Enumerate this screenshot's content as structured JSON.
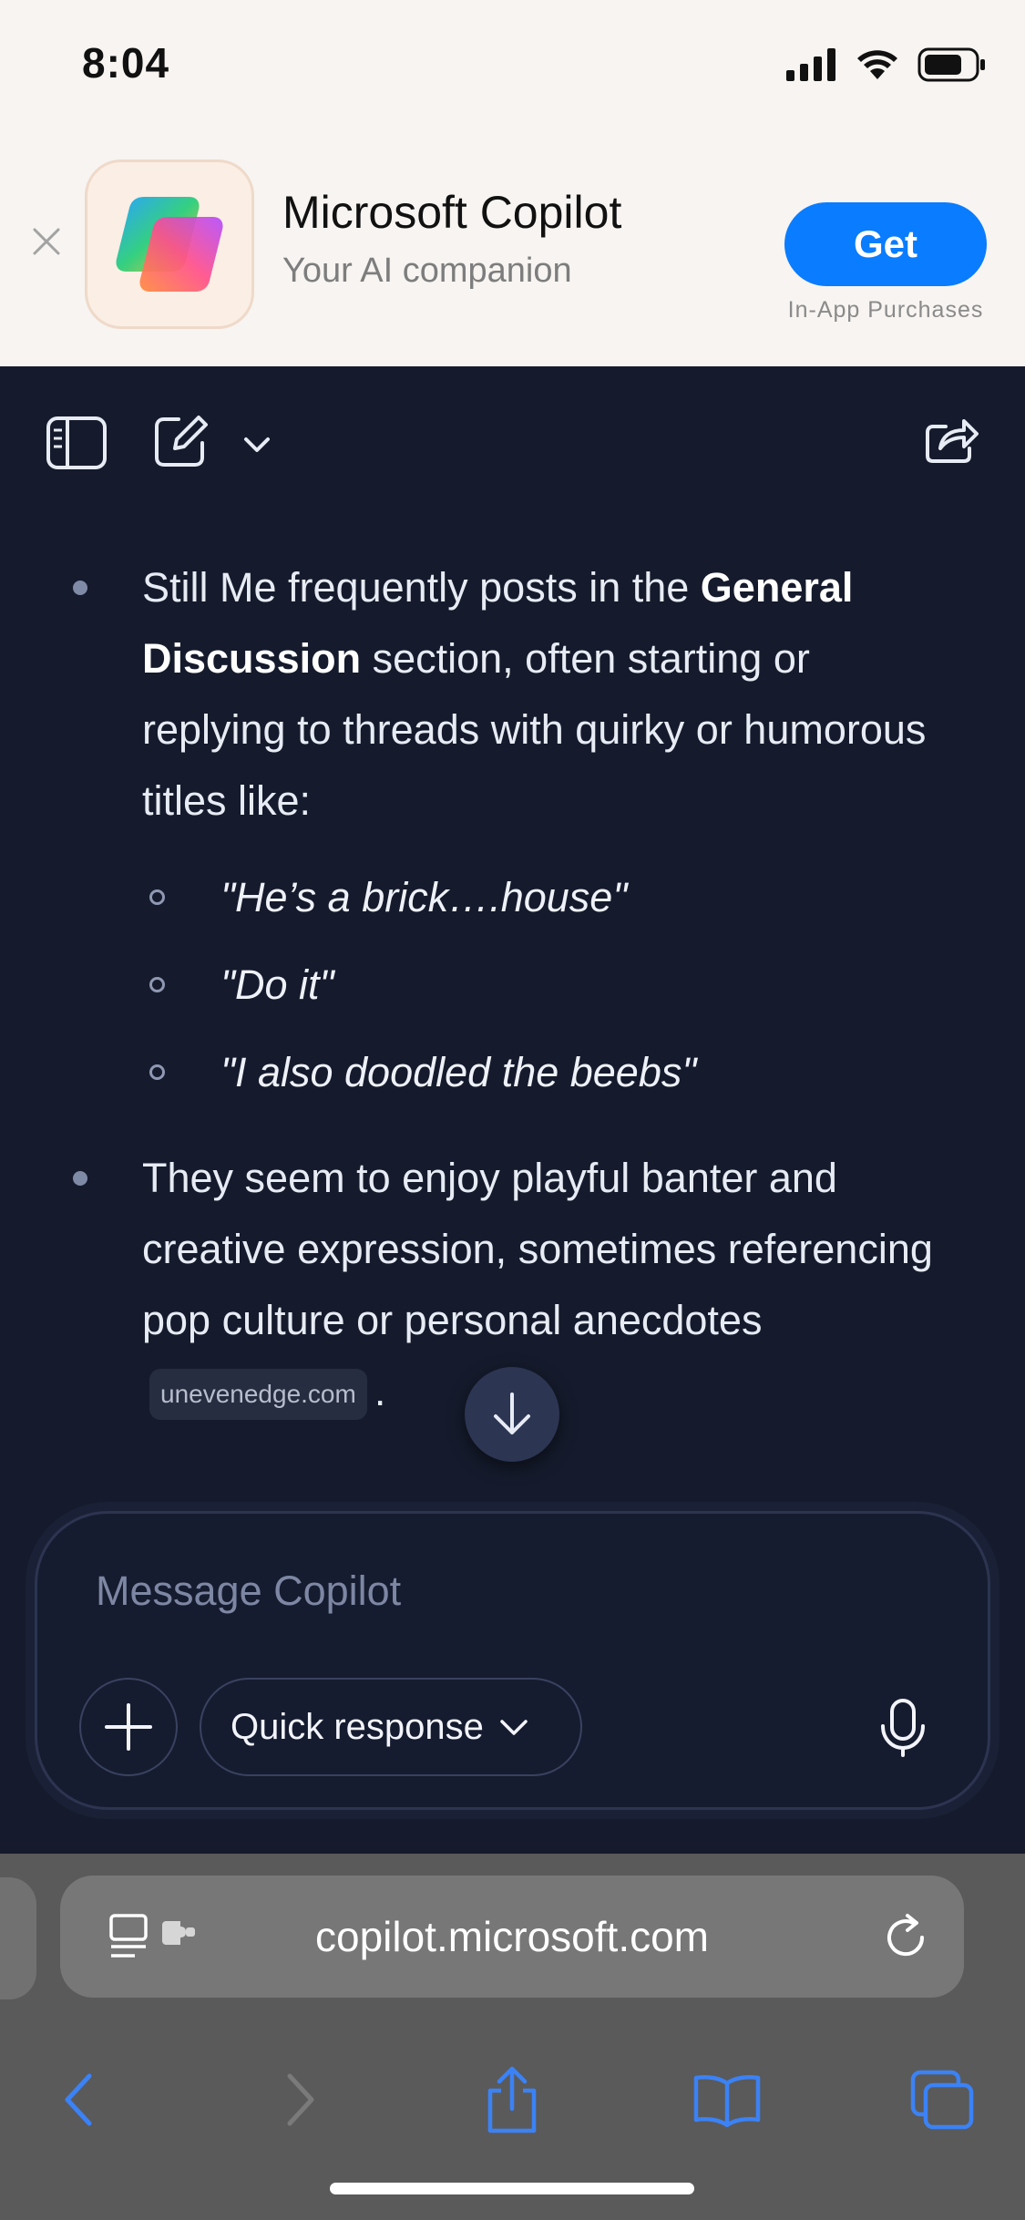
{
  "status_bar": {
    "time": "8:04"
  },
  "app_banner": {
    "app_name": "Microsoft Copilot",
    "subtitle": "Your AI companion",
    "get_label": "Get",
    "iap_note": "In-App Purchases"
  },
  "chat": {
    "bullet1": {
      "text_before": "Still Me frequently posts in the ",
      "bold": "General Discussion",
      "text_after": " section, often starting or replying to threads with quirky or humorous titles like:"
    },
    "sub_items": [
      "\"He’s a brick….house\"",
      "\"Do it\"",
      "\"I also doodled the beebs\""
    ],
    "bullet2": {
      "text": "They seem to enjoy playful banter and creative expression, sometimes referencing pop culture or personal anecdotes",
      "citation": "unevenedge.com",
      "trailing": "."
    }
  },
  "composer": {
    "placeholder": "Message Copilot",
    "quick_label": "Quick response"
  },
  "browser": {
    "url": "copilot.microsoft.com"
  },
  "colors": {
    "accent": "#0a7cff",
    "dark_bg": "#151b2c",
    "safari_bar": "#5a5a5a",
    "nav_blue": "#3b82f6"
  }
}
